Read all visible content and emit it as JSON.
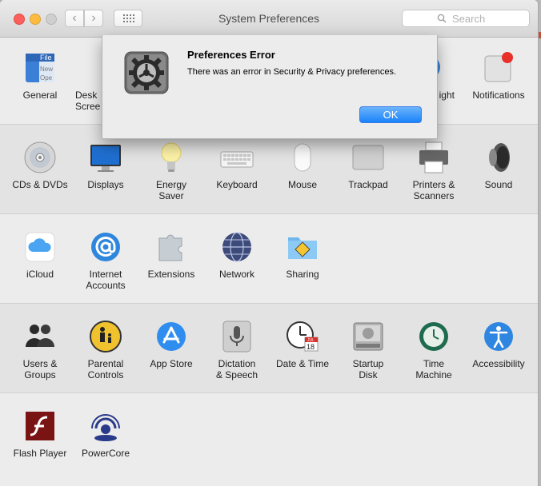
{
  "window": {
    "title": "System Preferences"
  },
  "toolbar": {
    "back_glyph": "‹",
    "forward_glyph": "›"
  },
  "search": {
    "placeholder": "Search"
  },
  "rows": [
    {
      "items": [
        {
          "label": "General",
          "icon": "general-icon"
        },
        {
          "label": "Desktop & Screen Saver",
          "icon": "desktop-icon"
        },
        {
          "label": "Spotlight",
          "icon": "spotlight-icon"
        },
        {
          "label": "Notifications",
          "icon": "notifications-icon"
        }
      ]
    },
    {
      "items": [
        {
          "label": "CDs & DVDs",
          "icon": "cd-icon"
        },
        {
          "label": "Displays",
          "icon": "display-icon"
        },
        {
          "label": "Energy Saver",
          "icon": "lightbulb-icon"
        },
        {
          "label": "Keyboard",
          "icon": "keyboard-icon"
        },
        {
          "label": "Mouse",
          "icon": "mouse-icon"
        },
        {
          "label": "Trackpad",
          "icon": "trackpad-icon"
        },
        {
          "label": "Printers & Scanners",
          "icon": "printer-icon"
        },
        {
          "label": "Sound",
          "icon": "speaker-icon"
        }
      ]
    },
    {
      "items": [
        {
          "label": "iCloud",
          "icon": "cloud-icon"
        },
        {
          "label": "Internet Accounts",
          "icon": "at-sign-icon"
        },
        {
          "label": "Extensions",
          "icon": "puzzle-icon"
        },
        {
          "label": "Network",
          "icon": "globe-icon"
        },
        {
          "label": "Sharing",
          "icon": "sharing-folder-icon"
        }
      ]
    },
    {
      "items": [
        {
          "label": "Users & Groups",
          "icon": "users-icon"
        },
        {
          "label": "Parental Controls",
          "icon": "parental-icon"
        },
        {
          "label": "App Store",
          "icon": "app-store-icon"
        },
        {
          "label": "Dictation & Speech",
          "icon": "microphone-icon"
        },
        {
          "label": "Date & Time",
          "icon": "clock-icon"
        },
        {
          "label": "Startup Disk",
          "icon": "disk-icon"
        },
        {
          "label": "Time Machine",
          "icon": "time-machine-icon"
        },
        {
          "label": "Accessibility",
          "icon": "accessibility-icon"
        }
      ]
    },
    {
      "items": [
        {
          "label": "Flash Player",
          "icon": "flash-icon"
        },
        {
          "label": "PowerCore",
          "icon": "powercore-icon"
        }
      ]
    }
  ],
  "labels": {
    "general": "General",
    "desktop_l1": "Desk",
    "desktop_l2": "Scree",
    "spotlight": "ight",
    "notifications": "Notifications",
    "cds_dvds": "CDs & DVDs",
    "displays": "Displays",
    "energy_l1": "Energy",
    "energy_l2": "Saver",
    "keyboard": "Keyboard",
    "mouse": "Mouse",
    "trackpad": "Trackpad",
    "printers_l1": "Printers &",
    "printers_l2": "Scanners",
    "sound": "Sound",
    "icloud": "iCloud",
    "internet_l1": "Internet",
    "internet_l2": "Accounts",
    "extensions": "Extensions",
    "network": "Network",
    "sharing": "Sharing",
    "users_l1": "Users &",
    "users_l2": "Groups",
    "parental_l1": "Parental",
    "parental_l2": "Controls",
    "app_store": "App Store",
    "dictation_l1": "Dictation",
    "dictation_l2": "& Speech",
    "date_time": "Date & Time",
    "startup_l1": "Startup",
    "startup_l2": "Disk",
    "time_machine_l1": "Time",
    "time_machine_l2": "Machine",
    "accessibility": "Accessibility",
    "flash_player": "Flash Player",
    "powercore": "PowerCore"
  },
  "icon_text": {
    "general_file": "File",
    "general_new": "New",
    "general_ope": "Ope",
    "calendar_month": "JUL",
    "calendar_day": "18"
  },
  "dialog": {
    "title": "Preferences Error",
    "message": "There was an error in Security & Privacy preferences.",
    "ok_label": "OK",
    "icon": "gear-icon"
  },
  "colors": {
    "accent": "#1a82fb",
    "close": "#fc605c",
    "minimize": "#fdbc40",
    "notification_badge": "#e8302a"
  }
}
